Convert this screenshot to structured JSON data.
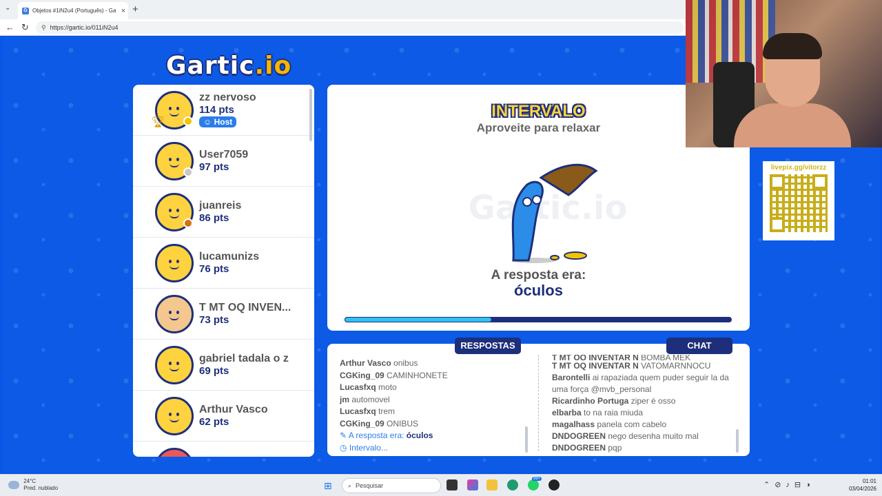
{
  "browser": {
    "tab_title": "Objetos #1iN2u4 (Português) - Ga",
    "url": "https://gartic.io/011iN2u4"
  },
  "game": {
    "logo": "Gartic",
    "logo_suffix": ".io",
    "players": [
      {
        "name": "zz nervoso",
        "pts": "114 pts",
        "host": "Host",
        "dot": "#f5c400",
        "avatar": "yellow",
        "trophy": "1"
      },
      {
        "name": "User7059",
        "pts": "97 pts",
        "dot": "#c8c8c8",
        "avatar": "yellow"
      },
      {
        "name": "juanreis",
        "pts": "86 pts",
        "dot": "#d7700f",
        "avatar": "yellow"
      },
      {
        "name": "lucamunizs",
        "pts": "76 pts",
        "avatar": "yellow"
      },
      {
        "name": "T MT OQ INVEN...",
        "pts": "73 pts",
        "avatar": "pink"
      },
      {
        "name": "gabriel tadala o z",
        "pts": "69 pts",
        "avatar": "yellow"
      },
      {
        "name": "Arthur Vasco",
        "pts": "62 pts",
        "avatar": "yellow"
      }
    ],
    "status_title": "INTERVALO",
    "status_subtitle": "Aproveite para relaxar",
    "answer_label": "A resposta era:",
    "answer": "óculos",
    "progress": 0.38,
    "tabs": {
      "answers": "RESPOSTAS",
      "chat": "CHAT"
    },
    "answers": [
      {
        "user": "Arthur Vasco",
        "text": "onibus"
      },
      {
        "user": "CGKing_09",
        "text": "CAMINHONETE"
      },
      {
        "user": "Lucasfxq",
        "text": "moto"
      },
      {
        "user": "jm",
        "text": "automovel"
      },
      {
        "user": "Lucasfxq",
        "text": "trem"
      },
      {
        "user": "CGKing_09",
        "text": "ONIBUS"
      }
    ],
    "answer_system": {
      "icon": "pencil-icon",
      "label": "A resposta era:",
      "word": "óculos"
    },
    "interval_system": {
      "icon": "clock-icon",
      "label": "Intervalo..."
    },
    "chat": [
      {
        "user": "T MT OQ INVENTAR N",
        "text": "BOMBA MEK"
      },
      {
        "user": "T MT OQ INVENTAR N",
        "text": "VATOMARNNOCU"
      },
      {
        "user": "Barontelli",
        "text": "ai rapaziada quem puder seguir la da uma força @mvb_personal"
      },
      {
        "user": "Ricardinho Portuga",
        "text": "ziper é osso"
      },
      {
        "user": "elbarba",
        "text": "to na raia miuda"
      },
      {
        "user": "magalhass",
        "text": "panela com cabelo"
      },
      {
        "user": "DNDOGREEN",
        "text": "nego desenha muito mal"
      },
      {
        "user": "DNDOGREEN",
        "text": "pqp"
      }
    ]
  },
  "overlay": {
    "qr_text": "livepix.gg/vitorzz"
  },
  "taskbar": {
    "weather_temp": "24°C",
    "weather_desc": "Pred. nublado",
    "search_placeholder": "Pesquisar",
    "badge": "99+",
    "time": "01:01",
    "date": "03/04/2026"
  }
}
